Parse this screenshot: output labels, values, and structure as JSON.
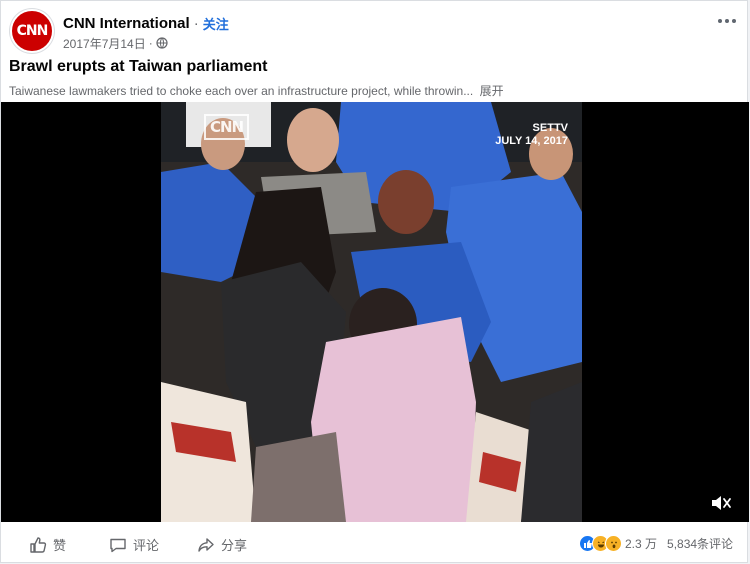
{
  "post": {
    "author": "CNN International",
    "separator": "·",
    "follow_label": "关注",
    "date": "2017年7月14日",
    "meta_separator": "·",
    "avatar_logo": "CNN",
    "title": "Brawl erupts at Taiwan parliament",
    "description": "Taiwanese lawmakers tried to choke each over an infrastructure project, while throwin...",
    "expand_label": "展开"
  },
  "video": {
    "watermark": "CNN",
    "channel": "SETTV",
    "date_stamp": "JULY 14, 2017",
    "muted": true
  },
  "actions": {
    "like_label": "赞",
    "comment_label": "评论",
    "share_label": "分享"
  },
  "stats": {
    "reactions_count": "2.3 万",
    "comments_count": "5,834条评论",
    "reaction_icons": [
      "like-icon",
      "laugh-icon",
      "wow-icon"
    ]
  },
  "colors": {
    "brand_red": "#cc0000",
    "follow_blue": "#216fdb",
    "like_blue": "#1877f2",
    "emoji_yellow": "#f7b125"
  }
}
